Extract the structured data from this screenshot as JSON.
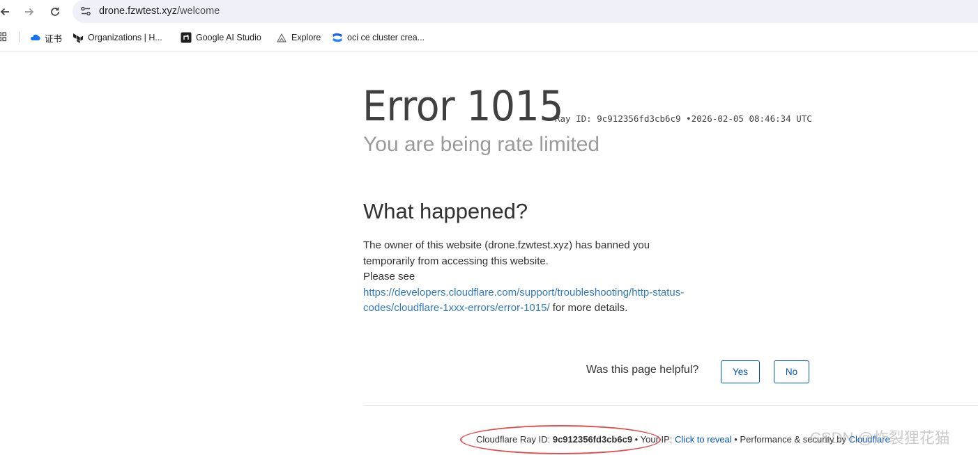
{
  "browser": {
    "url_host": "drone.fzwtest.xyz",
    "url_path": "/welcome",
    "bookmarks": [
      {
        "label": "证书",
        "icon": "cloud-icon"
      },
      {
        "label": "Organizations | H...",
        "icon": "terraform-icon"
      },
      {
        "label": "Google AI Studio",
        "icon": "ai-studio-icon"
      },
      {
        "label": "Explore",
        "icon": "explore-icon"
      },
      {
        "label": "oci ce cluster crea...",
        "icon": "confluence-icon"
      }
    ]
  },
  "error": {
    "title": "Error 1015",
    "ray_label": "Ray ID:",
    "ray_id": "9c912356fd3cb6c9",
    "bullet": "•",
    "timestamp": "2026-02-05 08:46:34 UTC",
    "subtitle": "You are being rate limited"
  },
  "what_happened": {
    "heading": "What happened?",
    "text_1": "The owner of this website (drone.fzwtest.xyz) has banned you temporarily from accessing this website.",
    "text_2": "Please see",
    "link": "https://developers.cloudflare.com/support/troubleshooting/http-status-codes/cloudflare-1xxx-errors/error-1015/",
    "text_3": "for more details."
  },
  "feedback": {
    "question": "Was this page helpful?",
    "yes_label": "Yes",
    "no_label": "No"
  },
  "footer": {
    "ray_label": "Cloudflare Ray ID:",
    "ray_id": "9c912356fd3cb6c9",
    "bullet": "•",
    "ip_label": "Your IP:",
    "ip_link": "Click to reveal",
    "perf_label": "Performance & security by",
    "cf_link": "Cloudflare"
  },
  "watermark": "CSDN @炸裂狸花猫",
  "colors": {
    "link": "#2f7bbf",
    "button_border": "#0051c3",
    "annotation": "#e0504f"
  }
}
